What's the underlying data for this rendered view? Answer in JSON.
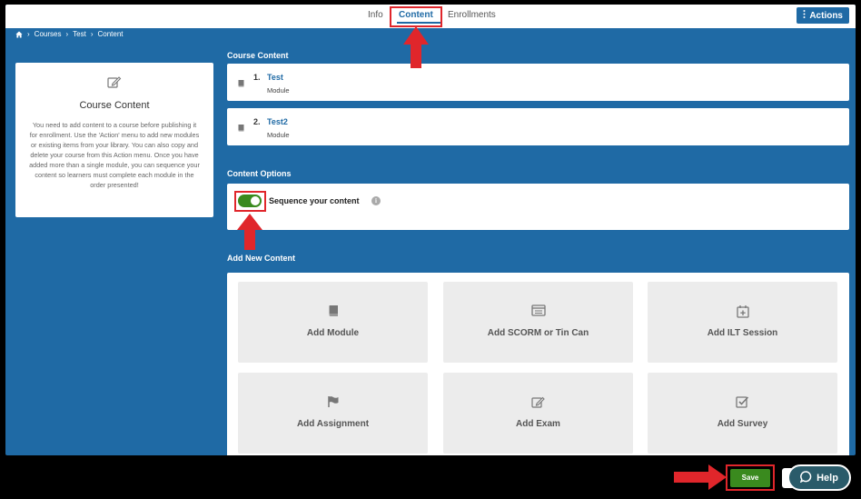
{
  "tabs": [
    {
      "label": "Info"
    },
    {
      "label": "Content"
    },
    {
      "label": "Enrollments"
    }
  ],
  "actions_button": {
    "label": "Actions"
  },
  "breadcrumb": [
    "Courses",
    "Test",
    "Content"
  ],
  "sidebar": {
    "title": "Course Content",
    "description": "You need to add content to a course before publishing it for enrollment. Use the 'Action' menu to add new modules or existing items from your library. You can also copy and delete your course from this Action menu. Once you have added more than a single module, you can sequence your content so learners must complete each module in the order presented!"
  },
  "course_content": {
    "heading": "Course Content",
    "modules": [
      {
        "number": "1.",
        "name": "Test",
        "type": "Module"
      },
      {
        "number": "2.",
        "name": "Test2",
        "type": "Module"
      }
    ]
  },
  "content_options": {
    "heading": "Content Options",
    "sequence_label": "Sequence your content",
    "sequence_enabled": true
  },
  "add_new_content": {
    "heading": "Add New Content",
    "tiles": [
      {
        "label": "Add Module",
        "icon": "book-icon"
      },
      {
        "label": "Add SCORM or Tin Can",
        "icon": "package-icon"
      },
      {
        "label": "Add ILT Session",
        "icon": "calendar-plus-icon"
      },
      {
        "label": "Add Assignment",
        "icon": "flag-icon"
      },
      {
        "label": "Add Exam",
        "icon": "edit-icon"
      },
      {
        "label": "Add Survey",
        "icon": "checkbox-icon"
      }
    ]
  },
  "footer": {
    "save_label": "Save",
    "help_label": "Help"
  },
  "colors": {
    "brand_blue": "#1f6aa5",
    "toggle_green": "#3a8a1e",
    "annotation_red": "#e0262b"
  }
}
